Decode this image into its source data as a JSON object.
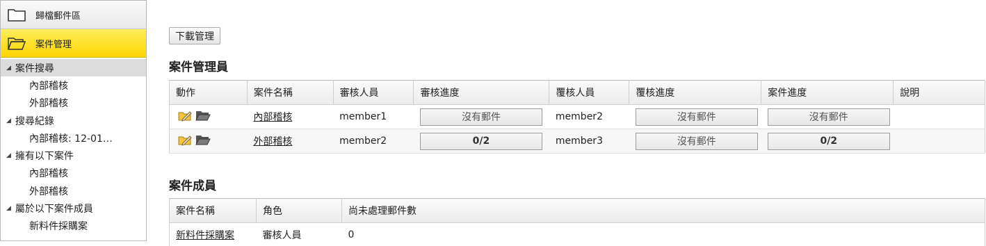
{
  "sidebar": {
    "archive_label": "歸檔郵件區",
    "case_mgmt_label": "案件管理",
    "sections": [
      {
        "label": "案件搜尋",
        "items": [
          "內部稽核",
          "外部稽核"
        ]
      },
      {
        "label": "搜尋紀錄",
        "items": [
          "內部稽核: 12-01…"
        ]
      },
      {
        "label": "擁有以下案件",
        "items": [
          "內部稽核",
          "外部稽核"
        ]
      },
      {
        "label": "屬於以下案件成員",
        "items": [
          "新料件採購案"
        ]
      }
    ]
  },
  "toolbar": {
    "download_label": "下載管理"
  },
  "admins": {
    "title": "案件管理員",
    "headers": [
      "動作",
      "案件名稱",
      "審核人員",
      "審核進度",
      "覆核人員",
      "覆核進度",
      "案件進度",
      "說明"
    ],
    "rows": [
      {
        "name": "內部稽核",
        "reviewer": "member1",
        "review_progress": "沒有郵件",
        "rechecker": "member2",
        "recheck_progress": "沒有郵件",
        "case_progress": "沒有郵件",
        "note": ""
      },
      {
        "name": "外部稽核",
        "reviewer": "member2",
        "review_progress": "0/2",
        "rechecker": "member3",
        "recheck_progress": "沒有郵件",
        "case_progress": "0/2",
        "note": ""
      }
    ]
  },
  "members": {
    "title": "案件成員",
    "headers": [
      "案件名稱",
      "角色",
      "尚未處理郵件數"
    ],
    "rows": [
      {
        "name": "新料件採購案",
        "role": "審核人員",
        "pending": "0"
      }
    ]
  },
  "icons": {
    "archive": "folder-icon",
    "case_mgmt": "folder-open-icon",
    "edit": "edit-icon",
    "open": "open-folder-icon"
  },
  "colors": {
    "active_nav": "#ffd400",
    "selected_tree": "#dcdcdc"
  }
}
